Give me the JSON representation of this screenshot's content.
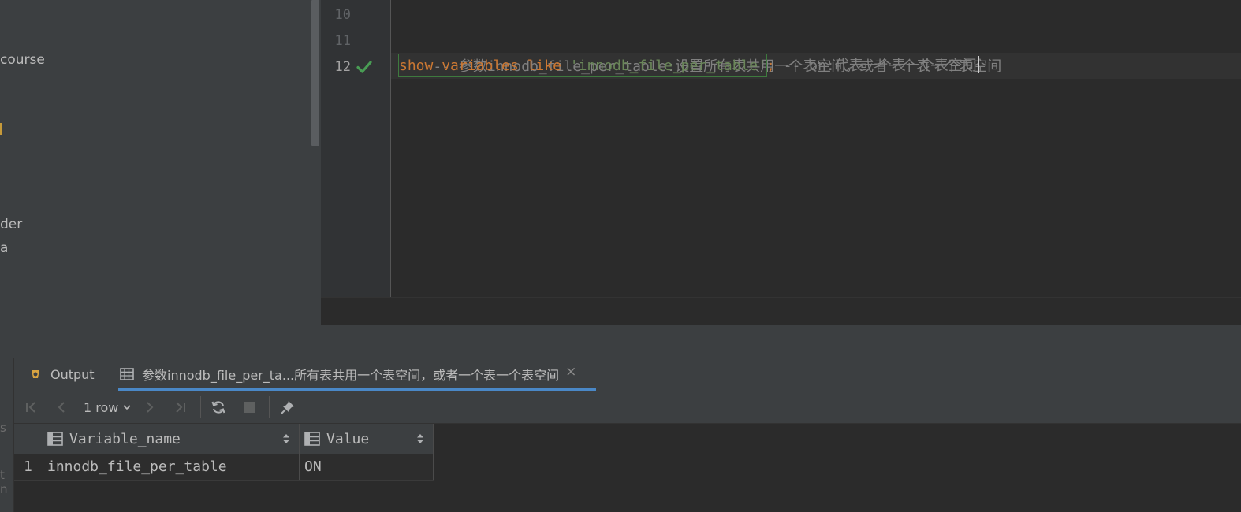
{
  "project_tree": {
    "items": [
      "course",
      "der",
      "a"
    ]
  },
  "editor": {
    "line_numbers": [
      "10",
      "11",
      "12"
    ],
    "line11_comment": "-- 参数innodb_file_per_table:设置所有表共用一个表空间，或者一个表一个表空间",
    "line12": {
      "kw_show": "show",
      "kw_variables": "variables",
      "kw_like": "like",
      "string": "'innodb_file_per_table'",
      "semicolon": ";",
      "comment_prefix": "-- on:",
      "comment_cjk": "代表一个表一个表空间"
    },
    "status_icon": "check-icon"
  },
  "bottom_panel": {
    "left_fragments": [
      "s",
      "t n"
    ],
    "tabs": [
      {
        "label": "Output",
        "icon": "output-icon"
      },
      {
        "label": "参数innodb_file_per_ta...所有表共用一个表空间，或者一个表一个表空间",
        "icon": "table-icon",
        "active": true
      }
    ],
    "toolbar": {
      "rows_label": "1 row",
      "icons": [
        "first-page-icon",
        "prev-page-icon",
        "next-page-icon",
        "last-page-icon",
        "refresh-icon",
        "stop-icon",
        "pin-icon"
      ]
    },
    "grid": {
      "columns": [
        "Variable_name",
        "Value"
      ],
      "rows": [
        {
          "num": "1",
          "cells": [
            "innodb_file_per_table",
            "ON"
          ]
        }
      ]
    }
  },
  "colors": {
    "keyword": "#cc7832",
    "string": "#6a8759",
    "comment": "#808080",
    "check": "#499c54",
    "tab_underline": "#4a88c7"
  }
}
